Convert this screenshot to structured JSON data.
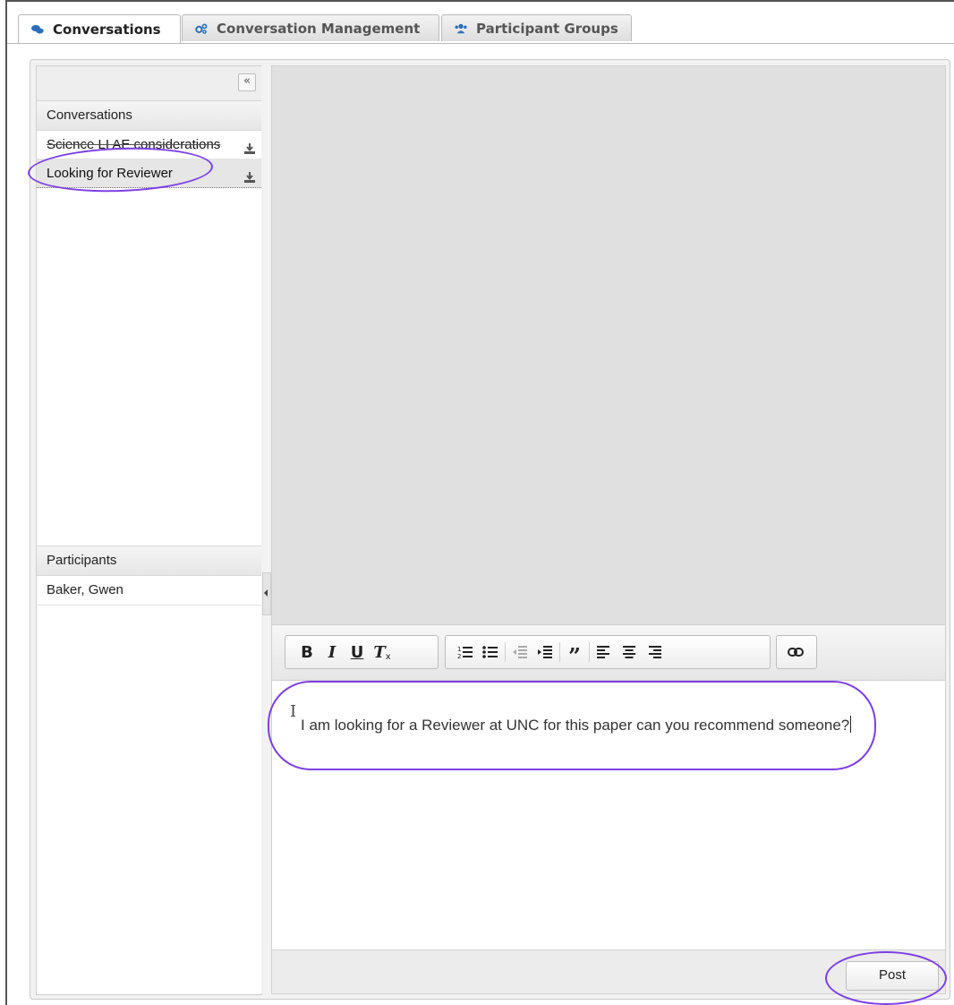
{
  "tabs": [
    {
      "label": "Conversations",
      "icon": "comments-icon",
      "active": true
    },
    {
      "label": "Conversation Management",
      "icon": "cogs-icon",
      "active": false
    },
    {
      "label": "Participant Groups",
      "icon": "users-icon",
      "active": false
    }
  ],
  "sidebar": {
    "collapse_symbol": "«",
    "conversations_header": "Conversations",
    "conversations": [
      {
        "title": "Science LI AE considerations",
        "icon": "download-icon"
      },
      {
        "title": "Looking for Reviewer",
        "icon": "download-icon",
        "selected": true
      }
    ],
    "participants_header": "Participants",
    "participants": [
      "Baker, Gwen"
    ]
  },
  "editor": {
    "toolbar_icons": [
      "bold-icon",
      "italic-icon",
      "underline-icon",
      "remove-format-icon",
      "numbered-list-icon",
      "bulleted-list-icon",
      "decrease-indent-icon",
      "increase-indent-icon",
      "blockquote-icon",
      "align-left-icon",
      "align-center-icon",
      "align-right-icon",
      "link-icon"
    ],
    "content": "I am looking for a Reviewer at UNC for this paper can you recommend someone?"
  },
  "footer": {
    "post_label": "Post"
  },
  "colors": {
    "annotation": "#7b3fe4"
  }
}
